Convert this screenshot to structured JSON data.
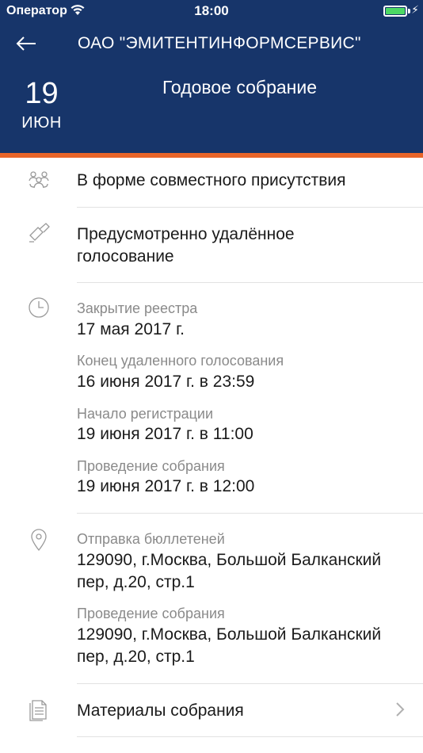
{
  "status_bar": {
    "carrier": "Оператор",
    "time": "18:00"
  },
  "nav": {
    "title": "ОАО \"ЭМИТЕНТИНФОРМСЕРВИС\""
  },
  "event": {
    "day": "19",
    "month": "ИЮН",
    "type": "Годовое собрание"
  },
  "sections": {
    "format": "В форме совместного присутствия",
    "remote_voting_line1": "Предусмотренно удалённое",
    "remote_voting_line2": "голосование",
    "dates": [
      {
        "label": "Закрытие реестра",
        "value": "17 мая 2017 г."
      },
      {
        "label": "Конец удаленного голосования",
        "value": "16 июня 2017 г. в 23:59"
      },
      {
        "label": "Начало регистрации",
        "value": "19 июня 2017 г. в 11:00"
      },
      {
        "label": "Проведение собрания",
        "value": "19 июня 2017 г. в 12:00"
      }
    ],
    "addresses": [
      {
        "label": "Отправка бюллетеней",
        "line1": "129090, г.Москва, Большой Балканский",
        "line2": "пер, д.20, стр.1"
      },
      {
        "label": "Проведение собрания",
        "line1": "129090, г.Москва, Большой Балканский",
        "line2": "пер, д.20, стр.1"
      }
    ],
    "materials": "Материалы собрания"
  },
  "colors": {
    "header_bg": "#17356a",
    "accent": "#e8652a",
    "battery": "#4cd964"
  },
  "icons": [
    "wifi-icon",
    "battery-icon",
    "back-arrow-icon",
    "people-meeting-icon",
    "ballot-pen-icon",
    "clock-icon",
    "location-pin-icon",
    "document-icon",
    "chevron-right-icon"
  ]
}
